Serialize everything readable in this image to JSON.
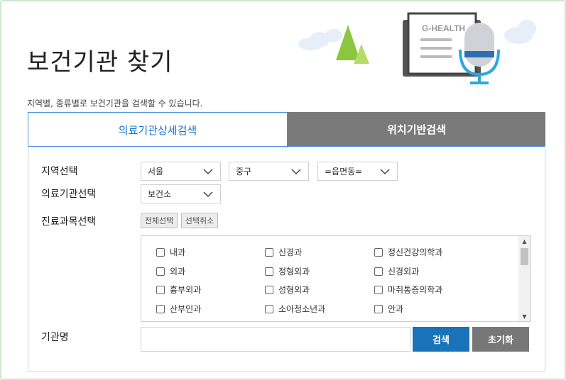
{
  "page": {
    "title": "보건기관 찾기",
    "subtitle": "지역별, 종류별로 보건기관을 검색할 수 있습니다.",
    "illustration_text": "G-HEALTH"
  },
  "tabs": [
    {
      "label": "의료기관상세검색",
      "active": true
    },
    {
      "label": "위치기반검색",
      "active": false
    }
  ],
  "labels": {
    "region": "지역선택",
    "institution": "의료기관선택",
    "department": "진료과목선택",
    "name": "기관명"
  },
  "selects": {
    "city": "서울",
    "district": "중구",
    "town": "=읍면동=",
    "institution_type": "보건소"
  },
  "dept_buttons": {
    "select_all": "전체선택",
    "deselect_all": "선택취소"
  },
  "departments": [
    [
      "내과",
      "신경과",
      "정신건강의학과"
    ],
    [
      "외과",
      "정형외과",
      "신경외과"
    ],
    [
      "흉부외과",
      "성형외과",
      "마취통증의학과"
    ],
    [
      "산부인과",
      "소아청소년과",
      "안과"
    ]
  ],
  "actions": {
    "search": "검색",
    "reset": "초기화",
    "name_placeholder": ""
  },
  "colors": {
    "accent": "#1a73b8",
    "tab_inactive": "#7a7a7a",
    "reset": "#777777"
  }
}
